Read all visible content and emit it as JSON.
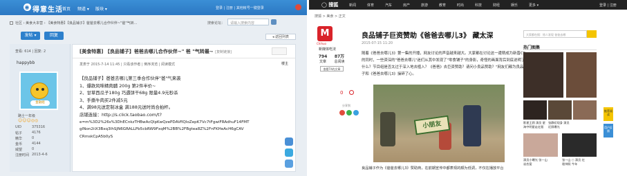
{
  "forum": {
    "logo": "得意生活",
    "nav": [
      "首页",
      "频道 ▾",
      "版块 ▾"
    ],
    "nav_right": "登录 | 注册 | 其他帐号一键登录",
    "breadcrumb": "社区 › 美食大本营 › 【美食特惠】【良品铺子】爸爸去哪儿合作伙伴~\"爸\"气转...",
    "search_label": "搜索论坛：",
    "search_placeholder": "请输入搜索内容",
    "post_button": "发帖 ▾",
    "reply_button": "回复",
    "back_button": "◂ 返回列表",
    "stats": "查看: 614 | 回复: 2",
    "user": {
      "name": "happybb",
      "rank": "路士一年级",
      "stars": "☺☺☺◎◎",
      "fields": [
        {
          "k": "UID",
          "v": "375316"
        },
        {
          "k": "帖子",
          "v": "4176"
        },
        {
          "k": "精华",
          "v": "0"
        },
        {
          "k": "金币",
          "v": "4144"
        },
        {
          "k": "威望",
          "v": "0"
        },
        {
          "k": "注册时间",
          "v": "2013-4-6"
        }
      ],
      "avatar_text": "金融组"
    },
    "post": {
      "title": "[美食特惠] 【良品铺子】爸爸去哪儿合作伙伴~\" 爸 \"气转最~",
      "title_tag": "[复制链接]",
      "meta": "发表于 2015-7-14 11:45 | 只看该作者 | 倒序浏览 | 阅读模式",
      "floor": "楼主",
      "lines": [
        "【良品铺子】爸爸去哪儿第三季合作伙伴\"爸\"气来袭",
        "1、爆款风味精肉脯 200g 第2件半价~",
        "2、甘草西瓜子180g 巧遇饼干68g 限量4.9元秒杀",
        "3、手撕牛肉买2件减5元",
        "4、满98元送定制冰盒 满188元送时尚合拍杆。",
        "店铺连接：http://s.click.taobao.com/t?",
        "e=m%3D2%26s%3DhECnkzTHBwAcQIpKwQzePDAVflQIoZepK7Vc7tFgwiFRAdhuF14FMT",
        "gINon2iiX3Bxq3IhSJN6GRALLPb5cbRW9FxqM%2BB%2FBgtea8Z%2FnFKHeAcH6gCAV",
        "CRmskCpA5b0yS"
      ]
    },
    "share_labels": [
      "分享",
      "收藏",
      "微信"
    ]
  },
  "news": {
    "logo": "◯ 搜狐",
    "nav": [
      "新闻",
      "体育",
      "汽车",
      "房产",
      "旅游",
      "教育",
      "时尚",
      "科技",
      "财经",
      "娱乐",
      "更多 ▾"
    ],
    "nav_right": "登录 | 注册",
    "breadcrumb": "搜狐 > 美食 > 正文",
    "media": {
      "logo": "M",
      "logo_sub": "Chihuo",
      "name": "新媒体吃法",
      "articles": "794",
      "articles_label": "文章",
      "reads": "87万",
      "reads_label": "总阅读",
      "subscribe": "查看TA的文章"
    },
    "title": "良品铺子巨资赞助《爸爸去哪儿3》 藏太深",
    "date": "2015-07-15 11:20",
    "paragraph": "随着《爸爸去哪儿3》第一集的开播，网友讨论的声音越来越大。大家都在讨论这一遭萌成为新晋CP的同时，一些资深的\"爸爸去哪儿\"迷们从其中发现了\"零食铺子\"的身影，奇怪的画面背后到底说明了什么？节目组是否太过于深入地去植入？《爸爸》去巨资赞助？请问小良品赞助？\"网友们都为良品铺子和《爸爸去哪儿3》操碎了心。",
    "comment_count": "0",
    "share_label": "分享到",
    "photo_label": "小朋友",
    "footer_text": "良品铺子作为《爸爸去哪儿3》赞助商，在前期宣传中都表现的颇为低调，不仅在播放平台",
    "search_placeholder": "大家都在搜：惊人发现 爸爸去哪",
    "hot_title": "热门图集",
    "hot_items": [
      {
        "caption": ""
      },
      {
        "caption": ""
      },
      {
        "caption": "影星王鸥 演员 星海中明星走红毯"
      },
      {
        "caption": "张静初现身 演员 近照曝光"
      },
      {
        "caption": "演员小曝光 张一山 谈恋爱"
      },
      {
        "caption": "张一山 ○ 演员 红毯帅照 今年"
      }
    ],
    "side_tabs": [
      "推荐阅读",
      "用户反馈"
    ]
  }
}
